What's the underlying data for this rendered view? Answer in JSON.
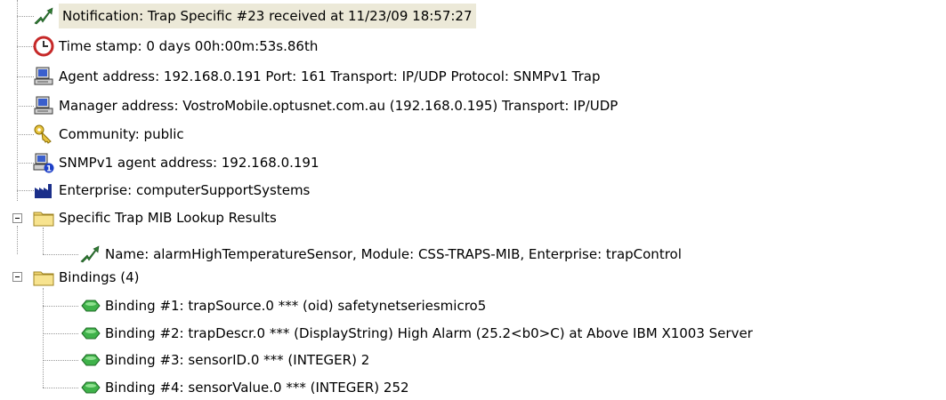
{
  "tree": {
    "notification": {
      "label": "Notification: Trap Specific #23 received at 11/23/09 18:57:27",
      "icon": "trap-lightning-icon"
    },
    "timestamp": {
      "label": "Time stamp: 0 days 00h:00m:53s.86th",
      "icon": "clock-icon"
    },
    "agent": {
      "label": "Agent address: 192.168.0.191 Port: 161 Transport: IP/UDP Protocol: SNMPv1 Trap",
      "icon": "computer-icon"
    },
    "manager": {
      "label": "Manager address: VostroMobile.optusnet.com.au (192.168.0.195) Transport: IP/UDP",
      "icon": "computer-icon"
    },
    "community": {
      "label": "Community: public",
      "icon": "key-icon"
    },
    "snmpv1_agent": {
      "label": "SNMPv1 agent address: 192.168.0.191",
      "icon": "computer-badge-icon"
    },
    "enterprise": {
      "label": "Enterprise: computerSupportSystems",
      "icon": "factory-icon"
    },
    "lookup": {
      "label": "Specific Trap MIB Lookup Results",
      "icon": "folder-icon",
      "children": [
        {
          "label": "Name: alarmHighTemperatureSensor, Module: CSS-TRAPS-MIB, Enterprise: trapControl",
          "icon": "trap-lightning-icon"
        }
      ]
    },
    "bindings": {
      "label": "Bindings (4)",
      "icon": "folder-icon",
      "children": [
        {
          "label": "Binding #1: trapSource.0 *** (oid) safetynetseriesmicro5",
          "icon": "binding-icon"
        },
        {
          "label": "Binding #2: trapDescr.0 *** (DisplayString) High Alarm (25.2<b0>C) at Above IBM X1003 Server",
          "icon": "binding-icon"
        },
        {
          "label": "Binding #3: sensorID.0 *** (INTEGER) 2",
          "icon": "binding-icon"
        },
        {
          "label": "Binding #4: sensorValue.0 *** (INTEGER) 252",
          "icon": "binding-icon"
        }
      ]
    }
  },
  "colors": {
    "selection_bg": "#ece9d8",
    "binding_green": "#3fb24a",
    "folder_yellow": "#f2d774",
    "trap_green": "#2e7d32"
  }
}
